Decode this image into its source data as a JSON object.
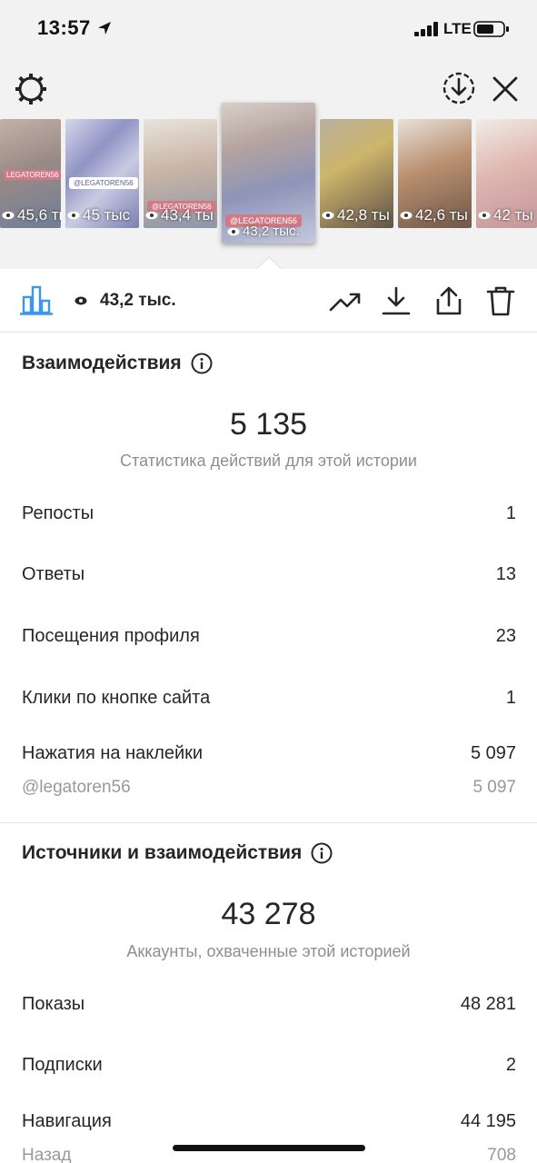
{
  "status_bar": {
    "time": "13:57",
    "network": "LTE"
  },
  "header": {
    "settings_icon": "gear-icon",
    "download_icon": "circle-download-icon",
    "close_icon": "close-icon"
  },
  "stories": [
    {
      "views": "45,6 ты",
      "tag": "LEGATOREN56"
    },
    {
      "views": "45 тыс",
      "tag": "@LEGATOREN56"
    },
    {
      "views": "43,4 ты",
      "tag": "@LEGATOREN56"
    },
    {
      "views": "43,2 тыс.",
      "tag": "@LEGATOREN56"
    },
    {
      "views": "42,8 ты",
      "tag": ""
    },
    {
      "views": "42,6 ты",
      "tag": ""
    },
    {
      "views": "42 ты",
      "tag": ""
    }
  ],
  "toolbar": {
    "views": "43,2 тыс."
  },
  "interactions": {
    "title": "Взаимодействия",
    "total": "5 135",
    "caption": "Статистика действий для этой истории",
    "rows": [
      {
        "label": "Репосты",
        "value": "1"
      },
      {
        "label": "Ответы",
        "value": "13"
      },
      {
        "label": "Посещения профиля",
        "value": "23"
      },
      {
        "label": "Клики по кнопке сайта",
        "value": "1"
      },
      {
        "label": "Нажатия на наклейки",
        "value": "5 097"
      }
    ],
    "sticker_sub": {
      "label": "@legatoren56",
      "value": "5 097"
    }
  },
  "discovery": {
    "title": "Источники и взаимодействия",
    "total": "43 278",
    "caption": "Аккаунты, охваченные этой историей",
    "rows": [
      {
        "label": "Показы",
        "value": "48 281"
      },
      {
        "label": "Подписки",
        "value": "2"
      },
      {
        "label": "Навигация",
        "value": "44 195"
      }
    ],
    "nav_sub": {
      "label": "Назад",
      "value": "708"
    }
  },
  "colors": {
    "accent": "#3897f0",
    "background": "#f2f2f2",
    "text": "#262626",
    "muted": "#8e8e8e"
  }
}
